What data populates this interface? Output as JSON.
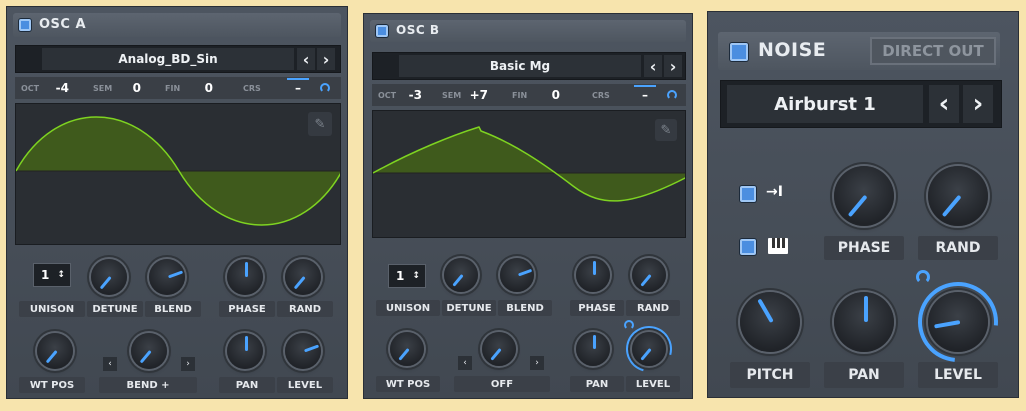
{
  "osc_a": {
    "title": "OSC A",
    "preset": "Analog_BD_Sin",
    "params": {
      "oct_label": "OCT",
      "oct_value": "-4",
      "sem_label": "SEM",
      "sem_value": "0",
      "fin_label": "FIN",
      "fin_value": "0",
      "crs_label": "CRS",
      "crs_value": "–"
    },
    "unison_value": "1",
    "labels": {
      "unison": "UNISON",
      "detune": "DETUNE",
      "blend": "BLEND",
      "phase": "PHASE",
      "rand": "RAND",
      "wtpos": "WT POS",
      "warp": "BEND +",
      "pan": "PAN",
      "level": "LEVEL"
    }
  },
  "osc_b": {
    "title": "OSC B",
    "preset": "Basic Mg",
    "params": {
      "oct_label": "OCT",
      "oct_value": "-3",
      "sem_label": "SEM",
      "sem_value": "+7",
      "fin_label": "FIN",
      "fin_value": "0",
      "crs_label": "CRS",
      "crs_value": "–"
    },
    "unison_value": "1",
    "labels": {
      "unison": "UNISON",
      "detune": "DETUNE",
      "blend": "BLEND",
      "phase": "PHASE",
      "rand": "RAND",
      "wtpos": "WT POS",
      "warp": "OFF",
      "pan": "PAN",
      "level": "LEVEL"
    }
  },
  "noise": {
    "title": "NOISE",
    "direct_out": "DIRECT OUT",
    "preset": "Airburst 1",
    "labels": {
      "phase": "PHASE",
      "rand": "RAND",
      "pitch": "PITCH",
      "pan": "PAN",
      "level": "LEVEL"
    }
  },
  "icons": {
    "prev": "‹",
    "next": "›",
    "spin": "↕",
    "edit": "✎",
    "keytrack": "→I"
  },
  "colors": {
    "accent": "#4aa3ff",
    "wave_fill": "#3f5a1c",
    "wave_line": "#7ed321",
    "background": "#f7e4ad"
  }
}
